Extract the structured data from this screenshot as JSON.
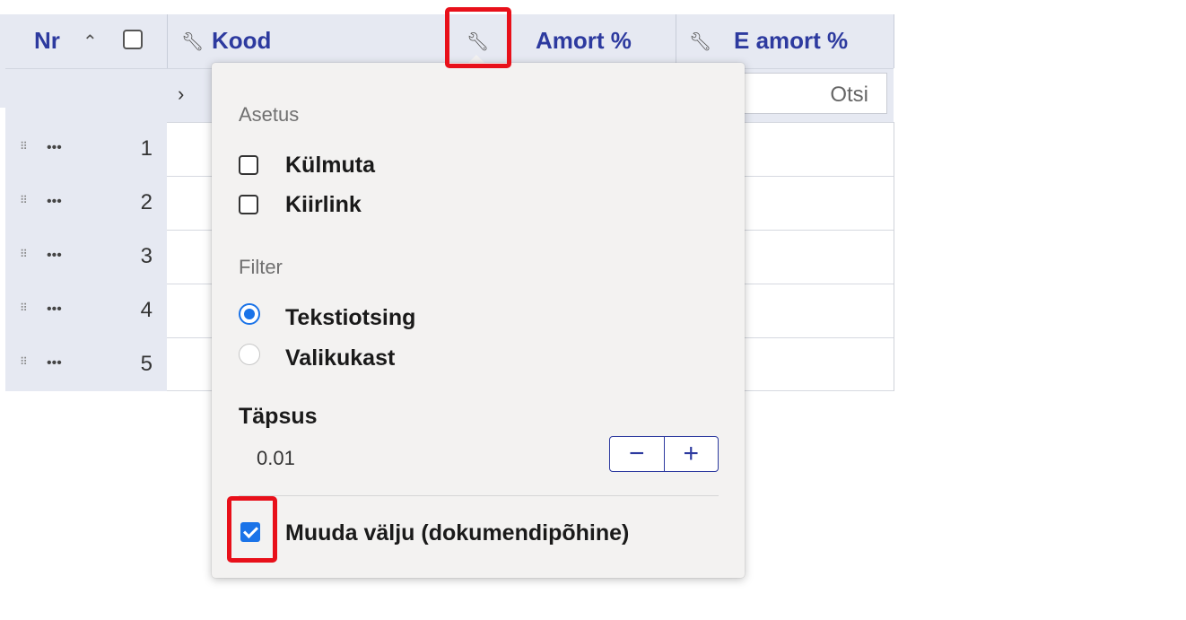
{
  "header": {
    "nr_label": "Nr",
    "sort_icon": "chevron-up-icon",
    "kood_label": "Kood",
    "amort_label": "Amort %",
    "eamort_label": "E amort %"
  },
  "filter_row": {
    "search_placeholder": "Otsi"
  },
  "rows": [
    "1",
    "2",
    "3",
    "4",
    "5"
  ],
  "row_menu_label": "•••",
  "popup": {
    "section_setting": "Asetus",
    "freeze_label": "Külmuta",
    "quicklink_label": "Kiirlink",
    "section_filter": "Filter",
    "text_search_label": "Tekstiotsing",
    "selectbox_label": "Valikukast",
    "precision_label": "Täpsus",
    "precision_value": "0.01",
    "minus_label": "−",
    "plus_label": "+",
    "editable_label": "Muuda välju (dokumendipõhine)"
  },
  "colors": {
    "accent": "#2d3a9f",
    "highlight": "#e8101a",
    "check": "#1a73e8"
  }
}
